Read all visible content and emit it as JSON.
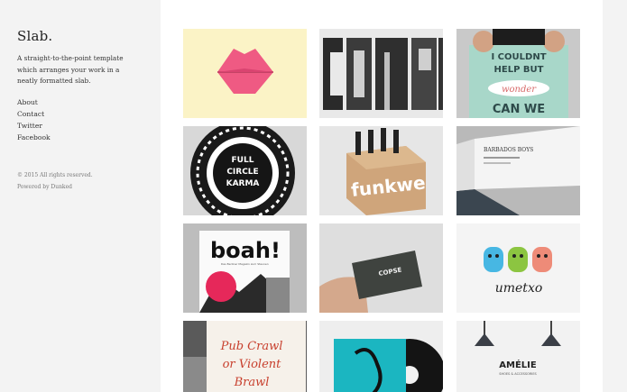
{
  "site": {
    "logo": "Slab.",
    "tagline": "A straight-to-the-point template which arranges your work in a neatly formatted slab."
  },
  "nav": [
    {
      "label": "About"
    },
    {
      "label": "Contact"
    },
    {
      "label": "Twitter"
    },
    {
      "label": "Facebook"
    }
  ],
  "footer": {
    "copyright": "© 2015 All rights reserved.",
    "powered": "Powered by Dunked"
  },
  "tiles": [
    {
      "name": "lips",
      "text": ""
    },
    {
      "name": "comp",
      "text": "COMP"
    },
    {
      "name": "i-couldnt",
      "line1": "I COULDNT",
      "line2": "HELP BUT",
      "line3": "wonder",
      "line4": "CAN WE"
    },
    {
      "name": "full-circle-karma",
      "line1": "FULL",
      "line2": "CIRCLE",
      "line3": "KARMA"
    },
    {
      "name": "funkwe",
      "text": "funkwe"
    },
    {
      "name": "barbados-boys",
      "text": "BARBADOS BOYS"
    },
    {
      "name": "boah",
      "text": "boah!",
      "sub": "Das Berliner Magazin zum Staunen"
    },
    {
      "name": "copse",
      "text": "COPSE"
    },
    {
      "name": "umetxo",
      "text": "umetxo"
    },
    {
      "name": "pub-crawl",
      "line1": "Pub Crawl",
      "line2": "or Violent",
      "line3": "Brawl"
    },
    {
      "name": "vinyl",
      "text": ""
    },
    {
      "name": "amelie",
      "text": "AMÉLIE",
      "sub": "SHOES & ACCESSORIES"
    }
  ],
  "colors": {
    "sidebar_bg": "#f3f3f3",
    "main_bg": "#ffffff",
    "text": "#333333"
  }
}
